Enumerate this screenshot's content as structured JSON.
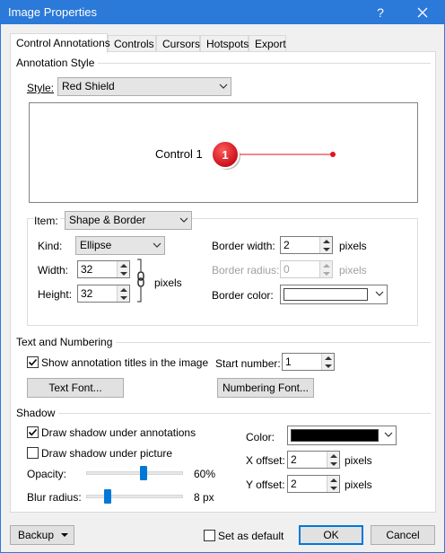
{
  "window": {
    "title": "Image Properties",
    "help_label": "?",
    "close_label": "✕"
  },
  "tabs": [
    {
      "label": "Control Annotations",
      "active": true
    },
    {
      "label": "Controls",
      "active": false
    },
    {
      "label": "Cursors",
      "active": false
    },
    {
      "label": "Hotspots",
      "active": false
    },
    {
      "label": "Export",
      "active": false
    }
  ],
  "annotation_style": {
    "heading": "Annotation Style",
    "style_label": "Style:",
    "style_value": "Red Shield",
    "preview": {
      "control_label": "Control 1",
      "badge_number": "1",
      "badge_color": "#e0141e",
      "line_color": "#e0141e"
    }
  },
  "item": {
    "label": "Item:",
    "value": "Shape & Border",
    "kind_label": "Kind:",
    "kind_value": "Ellipse",
    "width_label": "Width:",
    "width_value": "32",
    "height_label": "Height:",
    "height_value": "32",
    "size_unit": "pixels",
    "border_width_label": "Border width:",
    "border_width_value": "2",
    "border_width_unit": "pixels",
    "border_radius_label": "Border radius:",
    "border_radius_value": "0",
    "border_radius_unit": "pixels",
    "border_color_label": "Border color:",
    "border_color": "#ffffff"
  },
  "text_numbering": {
    "heading": "Text and Numbering",
    "show_titles_label": "Show annotation titles in the image",
    "show_titles_checked": true,
    "start_number_label": "Start number:",
    "start_number_value": "1",
    "text_font_button": "Text Font...",
    "numbering_font_button": "Numbering Font..."
  },
  "shadow": {
    "heading": "Shadow",
    "draw_under_annotations_label": "Draw shadow under annotations",
    "draw_under_annotations_checked": true,
    "draw_under_picture_label": "Draw shadow under picture",
    "draw_under_picture_checked": false,
    "opacity_label": "Opacity:",
    "opacity_value": "60%",
    "opacity_fraction": 0.6,
    "blur_label": "Blur radius:",
    "blur_value": "8 px",
    "blur_fraction": 0.2,
    "color_label": "Color:",
    "color": "#000000",
    "x_offset_label": "X offset:",
    "x_offset_value": "2",
    "x_offset_unit": "pixels",
    "y_offset_label": "Y offset:",
    "y_offset_value": "2",
    "y_offset_unit": "pixels"
  },
  "footer": {
    "backup_button": "Backup",
    "set_default_label": "Set as default",
    "set_default_checked": false,
    "ok_button": "OK",
    "cancel_button": "Cancel"
  },
  "accent_color": "#0078d7"
}
